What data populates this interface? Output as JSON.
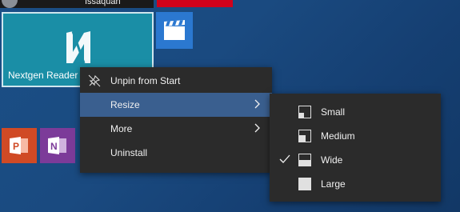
{
  "topbar": {
    "username": "Issaquah"
  },
  "tiles": {
    "nextgen": {
      "label": "Nextgen Reader",
      "color": "#1a8ea6"
    },
    "films": {
      "color": "#2b78d0"
    },
    "powerpoint": {
      "color": "#d04a25"
    },
    "onenote": {
      "color": "#7c3b99"
    }
  },
  "context_menu": {
    "items": [
      {
        "label": "Unpin from Start",
        "icon": "unpin-icon"
      },
      {
        "label": "Resize",
        "has_submenu": true,
        "highlighted": true
      },
      {
        "label": "More",
        "has_submenu": true
      },
      {
        "label": "Uninstall"
      }
    ]
  },
  "resize_submenu": {
    "items": [
      {
        "label": "Small",
        "icon": "small-size-icon",
        "checked": false
      },
      {
        "label": "Medium",
        "icon": "medium-size-icon",
        "checked": false
      },
      {
        "label": "Wide",
        "icon": "wide-size-icon",
        "checked": true
      },
      {
        "label": "Large",
        "icon": "large-size-icon",
        "checked": false
      }
    ]
  },
  "colors": {
    "menu_bg": "#2b2b2b",
    "highlight": "#3a5f8f",
    "accent_red": "#d0021b"
  }
}
